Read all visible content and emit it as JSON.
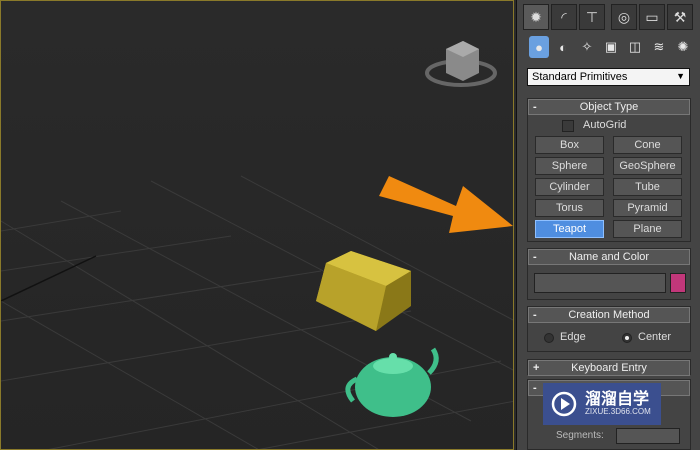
{
  "command_panel": {
    "tabs": [
      {
        "icon": "create-icon"
      },
      {
        "icon": "modify-icon"
      },
      {
        "icon": "hierarchy-icon"
      },
      {
        "icon": "motion-icon"
      },
      {
        "icon": "display-icon"
      },
      {
        "icon": "utilities-icon"
      }
    ],
    "sub_icons": [
      "geometry-icon",
      "shapes-icon",
      "lights-icon",
      "cameras-icon",
      "helpers-icon",
      "spacewarps-icon",
      "systems-icon"
    ],
    "dropdown": {
      "selected": "Standard Primitives"
    },
    "object_type": {
      "title": "Object Type",
      "collapse_sign": "-",
      "autogrid_label": "AutoGrid",
      "buttons": [
        "Box",
        "Cone",
        "Sphere",
        "GeoSphere",
        "Cylinder",
        "Tube",
        "Torus",
        "Pyramid",
        "Teapot",
        "Plane"
      ],
      "active": "Teapot"
    },
    "name_color": {
      "title": "Name and Color",
      "collapse_sign": "-",
      "swatch": "#c2377a"
    },
    "creation_method": {
      "title": "Creation Method",
      "collapse_sign": "-",
      "edge": "Edge",
      "center": "Center",
      "selected": "Center"
    },
    "keyboard_entry": {
      "title": "Keyboard Entry",
      "collapse_sign": "+"
    },
    "params_partial": {
      "collapse_sign": "-",
      "label": "Segments:"
    }
  },
  "viewport": {
    "arrow_color": "#f08a10",
    "box_color": "#b8a22a",
    "teapot_color": "#3fbf8a"
  },
  "watermark": {
    "title": "溜溜自学",
    "url": "ZIXUE.3D66.COM"
  }
}
